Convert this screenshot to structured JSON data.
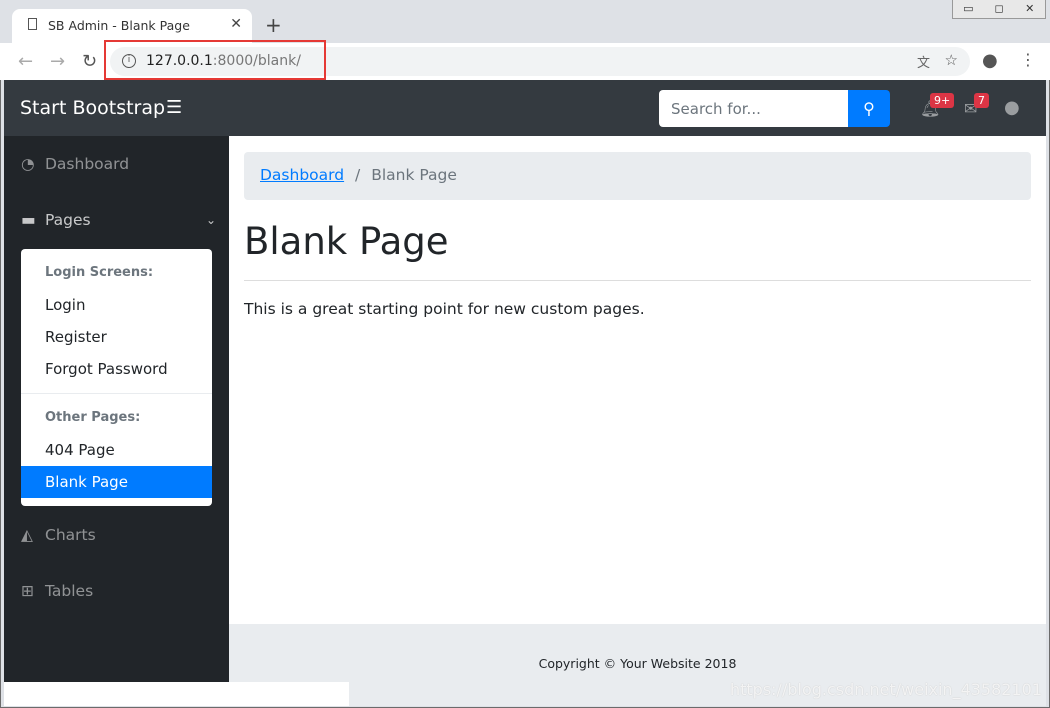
{
  "browser": {
    "tab_title": "SB Admin - Blank Page",
    "url_host": "127.0.0.1",
    "url_path": ":8000/blank/"
  },
  "navbar": {
    "brand": "Start Bootstrap",
    "search_placeholder": "Search for...",
    "alerts_badge": "9+",
    "messages_badge": "7"
  },
  "sidebar": {
    "items": [
      {
        "label": "Dashboard",
        "icon": "tachometer-icon"
      },
      {
        "label": "Pages",
        "icon": "folder-icon"
      },
      {
        "label": "Charts",
        "icon": "area-chart-icon"
      },
      {
        "label": "Tables",
        "icon": "table-icon"
      }
    ],
    "dropdown": {
      "header1": "Login Screens:",
      "items1": [
        "Login",
        "Register",
        "Forgot Password"
      ],
      "header2": "Other Pages:",
      "items2": [
        "404 Page",
        "Blank Page"
      ]
    }
  },
  "breadcrumb": {
    "link": "Dashboard",
    "sep": "/",
    "current": "Blank Page"
  },
  "main": {
    "title": "Blank Page",
    "text": "This is a great starting point for new custom pages."
  },
  "footer": {
    "copyright": "Copyright © Your Website 2018"
  },
  "watermark": "https://blog.csdn.net/weixin_43582101",
  "colors": {
    "primary": "#007bff",
    "navbar": "#343a40",
    "sidebar": "#212529",
    "badge": "#dc3545"
  }
}
